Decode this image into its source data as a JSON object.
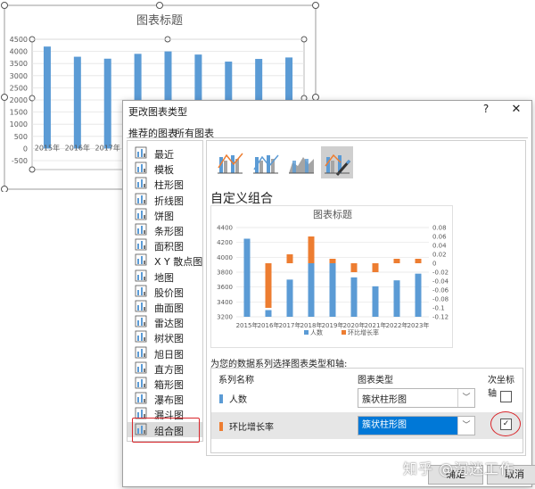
{
  "background_chart": {
    "title": "图表标题",
    "y_ticks": [
      "4500",
      "4000",
      "3500",
      "3000",
      "2500",
      "2000",
      "1500",
      "1000",
      "500",
      "0",
      "-500"
    ],
    "x_labels": [
      "2015年",
      "2016年",
      "2017年"
    ],
    "bar_values": [
      4200,
      3780,
      3700,
      3900,
      4000,
      3870,
      3580,
      3690,
      3750
    ],
    "ylim": [
      -500,
      4500
    ],
    "bar_color": "#5b9bd5"
  },
  "dialog": {
    "title": "更改图表类型",
    "help": "?",
    "close": "✕",
    "tabs": [
      "推荐的图表",
      "所有图表"
    ],
    "nav_items": [
      {
        "label": "最近",
        "icon": "recent-icon"
      },
      {
        "label": "模板",
        "icon": "template-icon"
      },
      {
        "label": "柱形图",
        "icon": "column-chart-icon"
      },
      {
        "label": "折线图",
        "icon": "line-chart-icon"
      },
      {
        "label": "饼图",
        "icon": "pie-chart-icon"
      },
      {
        "label": "条形图",
        "icon": "bar-chart-icon"
      },
      {
        "label": "面积图",
        "icon": "area-chart-icon"
      },
      {
        "label": "X Y 散点图",
        "icon": "scatter-chart-icon"
      },
      {
        "label": "地图",
        "icon": "map-chart-icon"
      },
      {
        "label": "股价图",
        "icon": "stock-chart-icon"
      },
      {
        "label": "曲面图",
        "icon": "surface-chart-icon"
      },
      {
        "label": "雷达图",
        "icon": "radar-chart-icon"
      },
      {
        "label": "树状图",
        "icon": "treemap-chart-icon"
      },
      {
        "label": "旭日图",
        "icon": "sunburst-chart-icon"
      },
      {
        "label": "直方图",
        "icon": "histogram-chart-icon"
      },
      {
        "label": "箱形图",
        "icon": "box-chart-icon"
      },
      {
        "label": "瀑布图",
        "icon": "waterfall-chart-icon"
      },
      {
        "label": "漏斗图",
        "icon": "funnel-chart-icon"
      },
      {
        "label": "组合图",
        "icon": "combo-chart-icon",
        "selected": true
      }
    ],
    "section_title": "自定义组合",
    "instruction": "为您的数据系列选择图表类型和轴:",
    "series_headers": {
      "name": "系列名称",
      "type": "图表类型",
      "secondary": "次坐标轴"
    },
    "series": [
      {
        "name": "人数",
        "type": "簇状柱形图",
        "secondary": false,
        "color": "#5b9bd5"
      },
      {
        "name": "环比增长率",
        "type": "簇状柱形图",
        "secondary": true,
        "color": "#ed7d31"
      }
    ],
    "ok_label": "确定",
    "cancel_label": "取消"
  },
  "chart_data": {
    "type": "bar",
    "title": "图表标题",
    "categories": [
      "2015年",
      "2016年",
      "2017年",
      "2018年",
      "2019年",
      "2020年",
      "2021年",
      "2022年",
      "2023年"
    ],
    "series": [
      {
        "name": "人数",
        "axis": "primary",
        "color": "#5b9bd5",
        "values": [
          4250,
          3290,
          3700,
          3930,
          3930,
          3730,
          3610,
          3690,
          3780
        ]
      },
      {
        "name": "环比增长率",
        "axis": "secondary",
        "color": "#ed7d31",
        "values": [
          null,
          -0.1,
          0.02,
          0.06,
          0.01,
          -0.02,
          -0.02,
          0.01,
          0.01
        ]
      }
    ],
    "primary_ticks": [
      "4400",
      "4200",
      "4000",
      "3800",
      "3600",
      "3400",
      "3200"
    ],
    "secondary_ticks": [
      "0.08",
      "0.06",
      "0.04",
      "0.02",
      "0",
      "-0.02",
      "-0.04",
      "-0.06",
      "-0.08",
      "-0.1",
      "-0.12"
    ],
    "ylim": [
      3200,
      4400
    ],
    "y2lim": [
      -0.12,
      0.08
    ],
    "legend": "bottom"
  },
  "watermark": "知乎 @沉迷工作"
}
